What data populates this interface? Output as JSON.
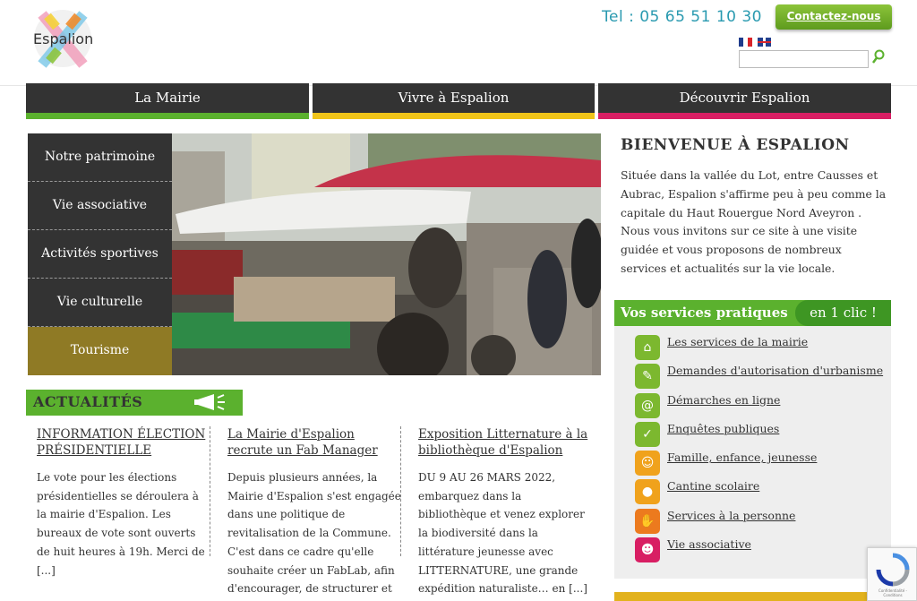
{
  "header": {
    "logo_text": "Espalion",
    "phone": "Tel : 05 65 51 10 30",
    "contact_label": "Contactez-nous"
  },
  "nav": [
    {
      "label": "La Mairie",
      "color": "#5bb12e"
    },
    {
      "label": "Vivre à Espalion",
      "color": "#f0c419"
    },
    {
      "label": "Découvrir Espalion",
      "color": "#d81e63"
    }
  ],
  "side_menu": [
    {
      "label": "Notre patrimoine"
    },
    {
      "label": "Vie associative"
    },
    {
      "label": "Activités sportives"
    },
    {
      "label": "Vie culturelle"
    },
    {
      "label": "Tourisme"
    }
  ],
  "welcome": {
    "title": "BIENVENUE À ESPALION",
    "text": "Située dans la vallée du Lot, entre Causses et Aubrac, Espalion s'affirme peu à peu comme la capitale du Haut Rouergue Nord Aveyron . Nous vous invitons sur ce site à une visite guidée et vous proposons de nombreux services et actualités sur la vie locale."
  },
  "services": {
    "title": "Vos services pratiques",
    "tag": "en 1 clic !",
    "items": [
      {
        "label": "Les services de la mairie",
        "icon": "town-hall-icon",
        "color": "#7cb82f"
      },
      {
        "label": "Demandes d'autorisation d'urbanisme",
        "icon": "document-icon",
        "color": "#7cb82f"
      },
      {
        "label": "Démarches en ligne",
        "icon": "online-form-icon",
        "color": "#7cb82f"
      },
      {
        "label": "Enquêtes publiques",
        "icon": "clipboard-icon",
        "color": "#7cb82f"
      },
      {
        "label": "Famille, enfance, jeunesse",
        "icon": "family-icon",
        "color": "#f0a21c"
      },
      {
        "label": "Cantine scolaire",
        "icon": "plate-icon",
        "color": "#f0a21c"
      },
      {
        "label": "Services à la personne",
        "icon": "hands-icon",
        "color": "#ec7a1e"
      },
      {
        "label": "Vie associative",
        "icon": "masks-icon",
        "color": "#d81e63"
      }
    ]
  },
  "news": {
    "title": "ACTUALITÉS",
    "items": [
      {
        "headline": "INFORMATION ÉLECTION PRÉSIDENTIELLE",
        "body": "Le vote pour les élections présidentielles se déroulera à la mairie d'Espalion. Les bureaux de vote sont ouverts de huit heures à 19h. Merci de [...]"
      },
      {
        "headline": "La Mairie d'Espalion recrute un Fab Manager",
        "body": "Depuis plusieurs années, la Mairie d'Espalion s'est engagée dans une politique de revitalisation de la Commune. C'est dans ce cadre qu'elle souhaite créer un FabLab, afin d'encourager, de structurer et"
      },
      {
        "headline": "Exposition Litternature à la bibliothèque d'Espalion",
        "body": "DU 9 AU 26 MARS 2022, embarquez dans la bibliothèque et venez explorer la biodiversité dans la littérature jeunesse avec LITTERNATURE, une grande expédition naturaliste… en [...]"
      }
    ]
  },
  "recaptcha": {
    "text": "Confidentialité - Conditions"
  }
}
